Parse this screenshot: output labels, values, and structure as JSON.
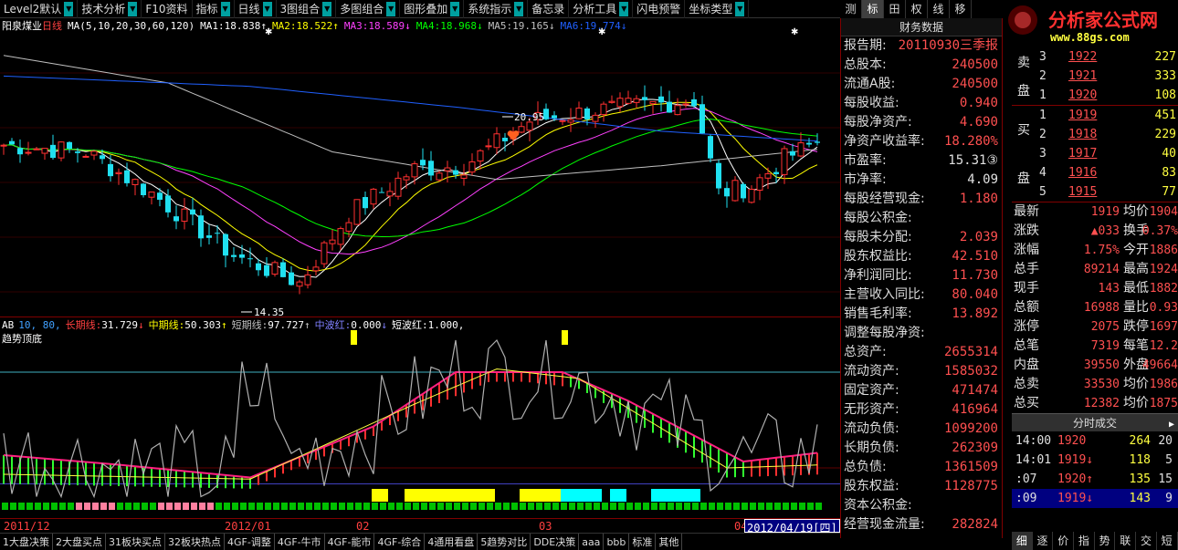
{
  "menu": [
    {
      "label": "Level2默认",
      "arrow": true
    },
    {
      "label": "技术分析",
      "arrow": true
    },
    {
      "label": "F10资料",
      "arrow": false
    },
    {
      "label": "指标",
      "arrow": true
    },
    {
      "label": "日线",
      "arrow": true
    },
    {
      "label": "3图组合",
      "arrow": true
    },
    {
      "label": "多图组合",
      "arrow": true
    },
    {
      "label": "图形叠加",
      "arrow": true
    },
    {
      "label": "系统指示",
      "arrow": true
    },
    {
      "label": "备忘录",
      "arrow": false
    },
    {
      "label": "分析工具",
      "arrow": true
    },
    {
      "label": "闪电预警",
      "arrow": false
    },
    {
      "label": "坐标类型",
      "arrow": true
    }
  ],
  "right_tabs": [
    "测",
    "标",
    "田",
    "权",
    "线",
    "移"
  ],
  "right_tab_active": 1,
  "logo": {
    "title": "分析家公式网",
    "url": "www.88gs.com"
  },
  "main": {
    "stock_name": "阳泉煤业",
    "period": "日线",
    "ma_params": "MA(5,10,20,30,60,120)",
    "ma": [
      {
        "label": "MA1:",
        "value": "18.838",
        "arrow": "↑",
        "color": "#ffffff"
      },
      {
        "label": "MA2:",
        "value": "18.522",
        "arrow": "↑",
        "color": "#ffff00"
      },
      {
        "label": "MA3:",
        "value": "18.589",
        "arrow": "↓",
        "color": "#ff40ff"
      },
      {
        "label": "MA4:",
        "value": "18.968",
        "arrow": "↓",
        "color": "#00ff00"
      },
      {
        "label": "MA5:",
        "value": "19.165",
        "arrow": "↓",
        "color": "#c0c0c0"
      },
      {
        "label": "MA6:",
        "value": "19.774",
        "arrow": "↓",
        "color": "#2060ff"
      }
    ],
    "high_label": "20.95",
    "low_label": "14.35"
  },
  "indicator": {
    "name": "AB",
    "params": "10, 80,",
    "title": "趋势顶底",
    "legend": [
      {
        "label": "长期线:",
        "value": "31.729",
        "arrow": "↓",
        "color": "#ff4040"
      },
      {
        "label": "中期线:",
        "value": "50.303",
        "arrow": "↑",
        "color": "#ffff00"
      },
      {
        "label": "短期线:",
        "value": "97.727",
        "arrow": "↑",
        "color": "#c0c0c0"
      },
      {
        "label": "中波红:",
        "value": "0.000",
        "arrow": "↓",
        "color": "#8080ff"
      },
      {
        "label": "短波红:",
        "value": "1.000,",
        "arrow": "",
        "color": "#ffffff"
      }
    ]
  },
  "xaxis": [
    "2011/12",
    "2012/01",
    "02",
    "03",
    "04"
  ],
  "date_flag": "2012/04/19[四]",
  "bottom_tabs": [
    "1大盘决策",
    "2大盘买点",
    "31板块买点",
    "32板块热点",
    "4GF-调整",
    "4GF-牛市",
    "4GF-能市",
    "4GF-综合",
    "4通用看盘",
    "5趋势对比",
    "DDE决策",
    "aaa",
    "bbb",
    "标准",
    "其他"
  ],
  "finance": {
    "header": "财务数据",
    "rows": [
      {
        "k": "报告期:",
        "v": "20110930三季报",
        "c": "r"
      },
      {
        "k": "总股本:",
        "v": "240500",
        "c": "r"
      },
      {
        "k": "流通A股:",
        "v": "240500",
        "c": "r"
      },
      {
        "k": "每股收益:",
        "v": "0.940",
        "c": "r"
      },
      {
        "k": "每股净资产:",
        "v": "4.690",
        "c": "r"
      },
      {
        "k": "净资产收益率:",
        "v": "18.280%",
        "c": "r"
      },
      {
        "k": "市盈率:",
        "v": "15.31③",
        "c": "w"
      },
      {
        "k": "市净率:",
        "v": "4.09",
        "c": "w"
      },
      {
        "k": "每股经营现金:",
        "v": "1.180",
        "c": "r"
      },
      {
        "k": "每股公积金:",
        "v": "",
        "c": "r"
      },
      {
        "k": "每股未分配:",
        "v": "2.039",
        "c": "r"
      },
      {
        "k": "股东权益比:",
        "v": "42.510",
        "c": "r"
      },
      {
        "k": "净利润同比:",
        "v": "11.730",
        "c": "r"
      },
      {
        "k": "主营收入同比:",
        "v": "80.040",
        "c": "r"
      },
      {
        "k": "销售毛利率:",
        "v": "13.892",
        "c": "r"
      },
      {
        "k": "调整每股净资:",
        "v": "",
        "c": "r"
      },
      {
        "k": "总资产:",
        "v": "2655314",
        "c": "r"
      },
      {
        "k": "流动资产:",
        "v": "1585032",
        "c": "r"
      },
      {
        "k": "固定资产:",
        "v": "471474",
        "c": "r"
      },
      {
        "k": "无形资产:",
        "v": "416964",
        "c": "r"
      },
      {
        "k": "流动负债:",
        "v": "1099200",
        "c": "r"
      },
      {
        "k": "长期负债:",
        "v": "262309",
        "c": "r"
      },
      {
        "k": "总负债:",
        "v": "1361509",
        "c": "r"
      },
      {
        "k": "股东权益:",
        "v": "1128775",
        "c": "r"
      },
      {
        "k": "资本公积金:",
        "v": "",
        "c": "r"
      },
      {
        "k": "经营现金流量:",
        "v": "282824",
        "c": "r"
      }
    ]
  },
  "orderbook": {
    "sell": [
      {
        "i": "3",
        "p": "1922",
        "v": "227"
      },
      {
        "i": "2",
        "p": "1921",
        "v": "333"
      },
      {
        "i": "1",
        "p": "1920",
        "v": "108"
      }
    ],
    "buy": [
      {
        "i": "1",
        "p": "1919",
        "v": "451"
      },
      {
        "i": "2",
        "p": "1918",
        "v": "229"
      },
      {
        "i": "3",
        "p": "1917",
        "v": "40"
      },
      {
        "i": "4",
        "p": "1916",
        "v": "83"
      },
      {
        "i": "5",
        "p": "1915",
        "v": "77"
      }
    ],
    "sell_label": "卖盘",
    "buy_label": "买盘"
  },
  "quote": [
    {
      "a": "最新",
      "b": "1919",
      "c": "均价",
      "d": "1904"
    },
    {
      "a": "涨跌",
      "b": "▲033",
      "c": "换手",
      "d": "0.37%"
    },
    {
      "a": "涨幅",
      "b": "1.75%",
      "c": "今开",
      "d": "1886"
    },
    {
      "a": "总手",
      "b": "89214",
      "c": "最高",
      "d": "1924"
    },
    {
      "a": "现手",
      "b": "143",
      "c": "最低",
      "d": "1882"
    },
    {
      "a": "总额",
      "b": "16988",
      "c": "量比",
      "d": "0.93"
    },
    {
      "a": "涨停",
      "b": "2075",
      "c": "跌停",
      "d": "1697"
    },
    {
      "a": "总笔",
      "b": "7319",
      "c": "每笔",
      "d": "12.2"
    },
    {
      "a": "内盘",
      "b": "39550",
      "c": "外盘",
      "d": "49664"
    },
    {
      "a": "总卖",
      "b": "33530",
      "c": "均价",
      "d": "1986"
    },
    {
      "a": "总买",
      "b": "12382",
      "c": "均价",
      "d": "1875"
    }
  ],
  "trades": {
    "header": "分时成交",
    "rows": [
      {
        "t": "14:00",
        "p": "1920",
        "q": "264",
        "n": "20",
        "sel": false
      },
      {
        "t": "14:01",
        "p": "1919↓",
        "q": "118",
        "n": "5",
        "sel": false
      },
      {
        "t": ":07",
        "p": "1920↑",
        "q": "135",
        "n": "15",
        "sel": false
      },
      {
        "t": ":09",
        "p": "1919↓",
        "q": "143",
        "n": "9",
        "sel": true
      }
    ]
  },
  "right_bottom_tabs": [
    "细",
    "逐",
    "价",
    "指",
    "势",
    "联",
    "交",
    "短"
  ],
  "right_bottom_active": 0,
  "colors": {
    "up": "#ff3030",
    "down": "#20e0f0",
    "ma1": "#ffffff",
    "ma2": "#ffff00",
    "ma3": "#ff40ff",
    "ma4": "#00ff00",
    "ma5": "#c0c0c0",
    "ma6": "#2060ff"
  }
}
